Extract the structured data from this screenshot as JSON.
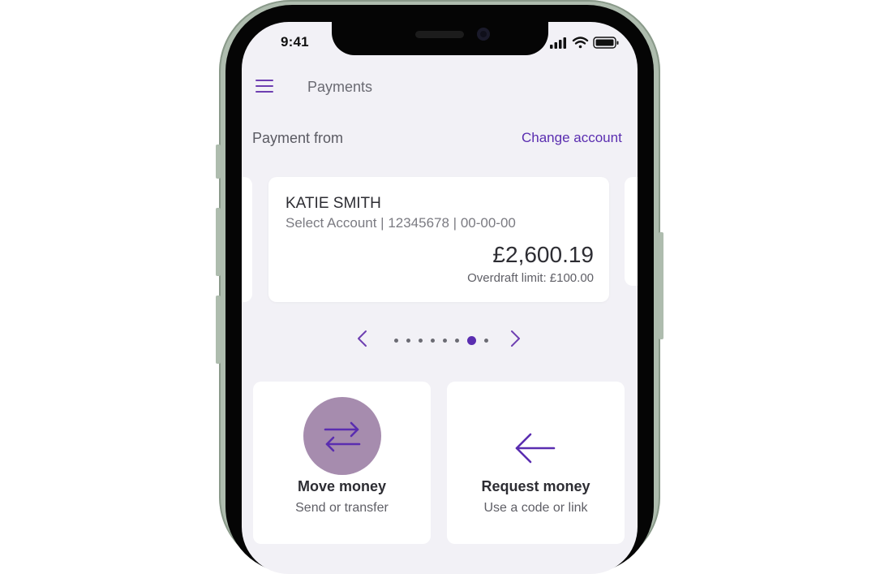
{
  "status_bar": {
    "time": "9:41"
  },
  "header": {
    "title": "Payments"
  },
  "payment_from": {
    "label": "Payment from",
    "change_link": "Change account"
  },
  "account": {
    "name": "KATIE SMITH",
    "details": "Select Account | 12345678 | 00-00-00",
    "balance": "£2,600.19",
    "overdraft": "Overdraft limit: £100.00"
  },
  "carousel": {
    "total": 8,
    "active_index": 6
  },
  "actions": [
    {
      "title": "Move money",
      "subtitle": "Send or transfer",
      "icon": "swap-arrows-icon"
    },
    {
      "title": "Request money",
      "subtitle": "Use a code or link",
      "icon": "arrow-left-icon"
    }
  ],
  "colors": {
    "accent": "#5a2db0",
    "background": "#f2f1f6",
    "move_circle": "#a68cae",
    "phone_frame": "#aebcae"
  }
}
